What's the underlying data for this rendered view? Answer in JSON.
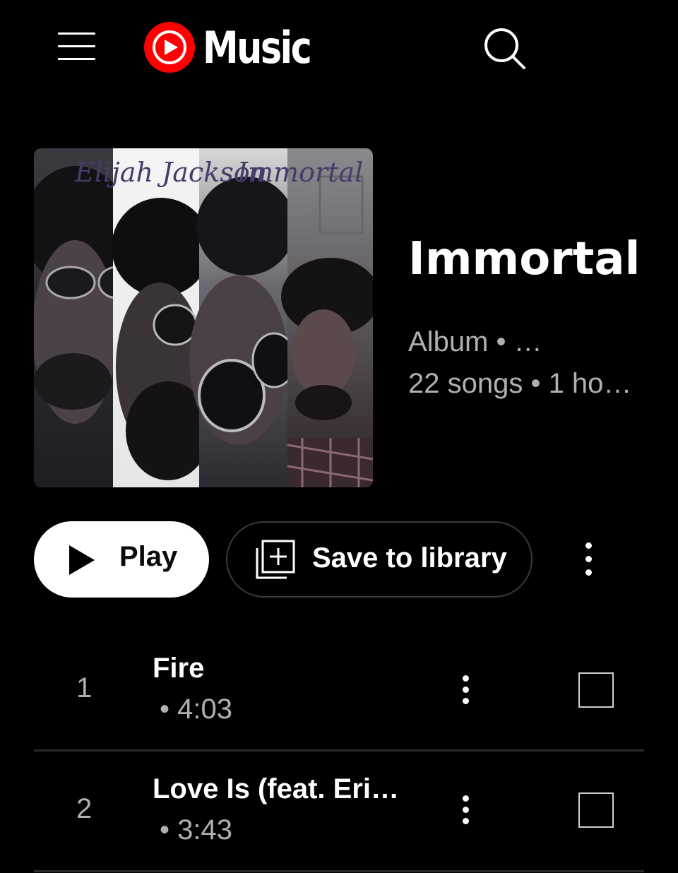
{
  "app": {
    "name": "Music",
    "brand_color": "#ff0000"
  },
  "header": {
    "menu_icon": "hamburger-menu-icon",
    "search_icon": "search-icon"
  },
  "album": {
    "cover_text_artist": "Elijah Jackson",
    "cover_text_title": "Immortal",
    "title": "Immortal",
    "meta_line1": "Album • …",
    "meta_line2": "22 songs • 1 ho…"
  },
  "actions": {
    "play_label": "Play",
    "save_label": "Save to library",
    "more_icon": "more-vertical-icon"
  },
  "tracks": [
    {
      "number": "1",
      "title": "Fire",
      "subtitle": "• 4:03"
    },
    {
      "number": "2",
      "title": "Love Is (feat. Eri…",
      "subtitle": "• 3:43"
    }
  ]
}
